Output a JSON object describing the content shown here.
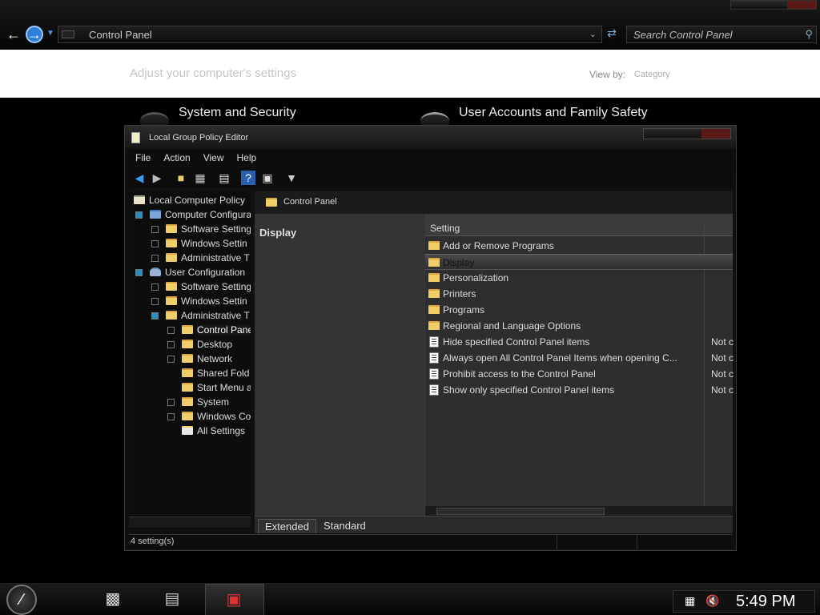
{
  "explorer": {
    "address": "Control Panel",
    "search_placeholder": "Search Control Panel",
    "heading": "Adjust your computer's settings",
    "view_by_label": "View by:",
    "view_by_value": "Category",
    "categories": [
      {
        "label": "System and Security"
      },
      {
        "label": "User Accounts and Family Safety"
      }
    ]
  },
  "gpe": {
    "title": "Local Group Policy Editor",
    "menu": [
      "File",
      "Action",
      "View",
      "Help"
    ],
    "tree": [
      {
        "label": "Local Computer Policy",
        "indent": 0,
        "expander": "none",
        "icon": "computer-policy-icon"
      },
      {
        "label": "Computer Configura",
        "indent": 1,
        "expander": "open",
        "icon": "computer-icon"
      },
      {
        "label": "Software Setting",
        "indent": 2,
        "expander": "closed",
        "icon": "folder-icon"
      },
      {
        "label": "Windows Settin",
        "indent": 2,
        "expander": "closed",
        "icon": "folder-icon"
      },
      {
        "label": "Administrative T",
        "indent": 2,
        "expander": "closed",
        "icon": "folder-icon"
      },
      {
        "label": "User Configuration",
        "indent": 1,
        "expander": "open",
        "icon": "user-icon"
      },
      {
        "label": "Software Setting",
        "indent": 2,
        "expander": "closed",
        "icon": "folder-icon"
      },
      {
        "label": "Windows Settin",
        "indent": 2,
        "expander": "closed",
        "icon": "folder-icon"
      },
      {
        "label": "Administrative T",
        "indent": 2,
        "expander": "open",
        "icon": "folder-icon"
      },
      {
        "label": "Control Pane",
        "indent": 3,
        "expander": "closed",
        "icon": "folder-icon",
        "selected": true
      },
      {
        "label": "Desktop",
        "indent": 3,
        "expander": "closed",
        "icon": "folder-icon"
      },
      {
        "label": "Network",
        "indent": 3,
        "expander": "closed",
        "icon": "folder-icon"
      },
      {
        "label": "Shared Fold",
        "indent": 3,
        "expander": "none",
        "icon": "folder-icon"
      },
      {
        "label": "Start Menu a",
        "indent": 3,
        "expander": "none",
        "icon": "folder-icon"
      },
      {
        "label": "System",
        "indent": 3,
        "expander": "closed",
        "icon": "folder-icon"
      },
      {
        "label": "Windows Co",
        "indent": 3,
        "expander": "closed",
        "icon": "folder-icon"
      },
      {
        "label": "All Settings",
        "indent": 3,
        "expander": "none",
        "icon": "all-settings-icon"
      }
    ],
    "right_header": "Control Panel",
    "description_title": "Display",
    "column_setting": "Setting",
    "rows": [
      {
        "name": "Add or Remove Programs",
        "type": "folder",
        "state": ""
      },
      {
        "name": "Display",
        "type": "folder",
        "state": "",
        "selected": true
      },
      {
        "name": "Personalization",
        "type": "folder",
        "state": ""
      },
      {
        "name": "Printers",
        "type": "folder",
        "state": ""
      },
      {
        "name": "Programs",
        "type": "folder",
        "state": ""
      },
      {
        "name": "Regional and Language Options",
        "type": "folder",
        "state": ""
      },
      {
        "name": "Hide specified Control Panel items",
        "type": "policy",
        "state": "Not c"
      },
      {
        "name": "Always open All Control Panel Items when opening C...",
        "type": "policy",
        "state": "Not c"
      },
      {
        "name": "Prohibit access to the Control Panel",
        "type": "policy",
        "state": "Not c"
      },
      {
        "name": "Show only specified Control Panel items",
        "type": "policy",
        "state": "Not c"
      }
    ],
    "tabs": [
      "Extended",
      "Standard"
    ],
    "status": "4 setting(s)"
  },
  "taskbar": {
    "clock": "5:49 PM"
  }
}
